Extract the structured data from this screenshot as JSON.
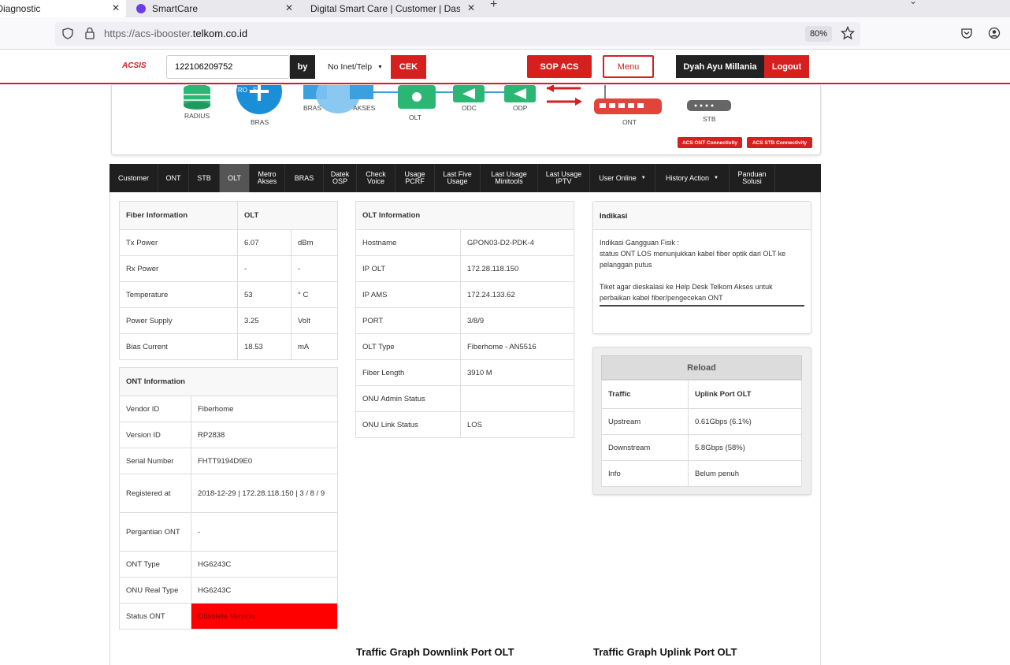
{
  "browser": {
    "tabs": [
      {
        "title": "- Diagnostic",
        "close": "✕"
      },
      {
        "title": "SmartCare",
        "close": "✕"
      },
      {
        "title": "Digital Smart Care | Customer | Dash",
        "close": "✕"
      }
    ],
    "new_tab": "+",
    "url_prefix": "https://acs-ibooster.",
    "url_domain": "telkom.co.id",
    "zoom": "80%"
  },
  "header": {
    "logo": "ACSIS",
    "search_value": "122106209752",
    "by_label": "by",
    "type_select": "No Inet/Telp",
    "cek_label": "CEK",
    "sop_label": "SOP ACS",
    "menu_label": "Menu",
    "user_name": "Dyah Ayu Millania",
    "logout_label": "Logout"
  },
  "topology": {
    "radius": "RADIUS",
    "bras": "BRAS",
    "bras2": "BRAS",
    "metro": "METRO - E",
    "akses": "AKSES",
    "olt": "OLT",
    "odc": "ODC",
    "odp": "ODP",
    "ont": "ONT",
    "stb": "STB",
    "ont_conn": "ACS ONT Connectivity",
    "stb_conn": "ACS STB Connectivity"
  },
  "nav_tabs": [
    "Customer",
    "ONT",
    "STB",
    "OLT",
    "Metro Akses",
    "BRAS",
    "Datek OSP",
    "Check Voice",
    "Usage PCRF",
    "Last Five Usage",
    "Last Usage Minitools",
    "Last Usage IPTV",
    "User Online",
    "History Action",
    "Panduan Solusi"
  ],
  "fiber": {
    "header": [
      "Fiber Information",
      "OLT"
    ],
    "rows": [
      [
        "Tx Power",
        "6.07",
        "dBm"
      ],
      [
        "Rx Power",
        "-",
        "-"
      ],
      [
        "Temperature",
        "53",
        "° C"
      ],
      [
        "Power Supply",
        "3.25",
        "Volt"
      ],
      [
        "Bias Current",
        "18.53",
        "mA"
      ]
    ]
  },
  "ont": {
    "header": "ONT Information",
    "rows": [
      [
        "Vendor ID",
        "Fiberhome"
      ],
      [
        "Version ID",
        "RP2838"
      ],
      [
        "Serial Number",
        "FHTT9194D9E0"
      ],
      [
        "Registered at",
        "2018-12-29 | 172.28.118.150 | 3 / 8 / 9"
      ],
      [
        "Pergantian ONT",
        "-"
      ],
      [
        "ONT Type",
        "HG6243C"
      ],
      [
        "ONU Real Type",
        "HG6243C"
      ],
      [
        "Status ONT",
        "Obsolete Version"
      ]
    ]
  },
  "olt": {
    "header": "OLT Information",
    "rows": [
      [
        "Hostname",
        "GPON03-D2-PDK-4"
      ],
      [
        "IP OLT",
        "172.28.118.150"
      ],
      [
        "IP AMS",
        "172.24.133.62"
      ],
      [
        "PORT",
        "3/8/9"
      ],
      [
        "OLT Type",
        "Fiberhome - AN5516"
      ],
      [
        "Fiber Length",
        "3910 M"
      ],
      [
        "ONU Admin Status",
        ""
      ],
      [
        "ONU Link Status",
        "LOS"
      ]
    ]
  },
  "indikasi": {
    "header": "Indikasi",
    "line1": "Indikasi Gangguan Fisik :",
    "line2": "status ONT LOS menunjukkan kabel fiber optik dari OLT ke pelanggan putus",
    "line3": "Tiket agar dieskalasi ke Help Desk Telkom Akses untuk perbaikan kabel fiber/pengecekan ONT"
  },
  "traffic": {
    "reload": "Reload",
    "header": [
      "Traffic",
      "Uplink Port OLT"
    ],
    "rows": [
      [
        "Upstream",
        "0.61Gbps (6.1%)"
      ],
      [
        "Downstream",
        "5.8Gbps (58%)"
      ],
      [
        "Info",
        "Belum penuh"
      ]
    ]
  },
  "graphs": {
    "downlink": "Traffic Graph Downlink Port OLT",
    "uplink": "Traffic Graph Uplink Port OLT"
  }
}
